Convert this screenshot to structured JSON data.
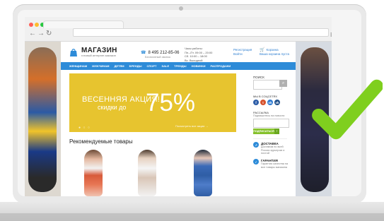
{
  "site": {
    "logo_title": "МАГАЗИН",
    "logo_subtitle": "готовый интернет-магазин",
    "phone": "8 495 212-85-06",
    "phone_note": "Бесплатный звонок",
    "hours_title": "Часы работы:",
    "hours_weekdays": "Пн.–Пт. 09:00 – 20:00",
    "hours_saturday": "Сб. 10:00 – 18:00",
    "hours_sunday": "Вс. Выходной",
    "auth_register": "Регистрация",
    "auth_login": "Войти",
    "cart_label": "Корзина",
    "cart_sub": "Ваша корзина пуста"
  },
  "navbar": {
    "items": [
      "ЖЕНЩИНАМ",
      "МУЖЧИНАМ",
      "ДЕТЯМ",
      "БРЕНДЫ",
      "СПОРТ",
      "SALE",
      "ТРЕНДЫ",
      "НОВИНКИ",
      "РАСПРОДАЖИ"
    ]
  },
  "banner": {
    "headline": "ВЕСЕННЯЯ АКЦИЯ!",
    "subline": "скидки до",
    "percent": "75%",
    "link": "Посмотреть все акции →",
    "dots": "● ○ ○"
  },
  "recommendations": {
    "title": "Рекомендуемые товары"
  },
  "sidebar": {
    "search_label": "ПОИСК",
    "search_placeholder": "",
    "search_icon_glyph": "⌕",
    "social_label": "МЫ В СОЦСЕТЯХ",
    "social": [
      {
        "label": "f"
      },
      {
        "label": "t"
      },
      {
        "label": "ok"
      },
      {
        "label": "vk"
      }
    ],
    "newsletter_label": "РАССЫЛКА",
    "newsletter_note": "Подпишитесь на новости",
    "subscribe_label": "ПОДПИСАТЬСЯ",
    "subscribe_arrow": "›",
    "delivery_title": "ДОСТАВКА",
    "delivery_text": "Доставим по всей России курьером и почтой",
    "warranty_title": "ГАРАНТИЯ",
    "warranty_text": "Гарантия качества на все товары магазина"
  },
  "colors": {
    "accent_blue": "#2d8bd8",
    "banner_yellow": "#e7c42f",
    "checkmark_green": "#7fcf1e"
  }
}
